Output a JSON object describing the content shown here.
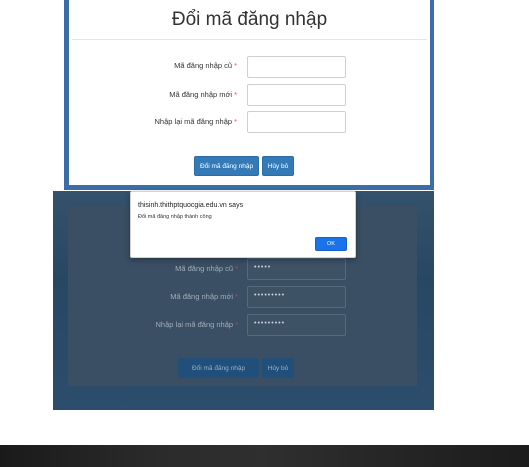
{
  "top_form": {
    "title": "Đổi mã đăng nhập",
    "fields": [
      {
        "label": "Mã đăng nhập cũ",
        "required": "*",
        "value": ""
      },
      {
        "label": "Mã đăng nhập mới",
        "required": "*",
        "value": ""
      },
      {
        "label": "Nhập lại mã đăng nhập",
        "required": "*",
        "value": ""
      }
    ],
    "submit_label": "Đổi mã đăng nhập",
    "cancel_label": "Hủy bỏ"
  },
  "bottom_form": {
    "fields": [
      {
        "label": "Mã đăng nhập cũ",
        "required": "*",
        "value": "•••••"
      },
      {
        "label": "Mã đăng nhập mới",
        "required": "*",
        "value": "•••••••••"
      },
      {
        "label": "Nhập lại mã đăng nhập",
        "required": "*",
        "value": "•••••••••"
      }
    ],
    "submit_label": "Đổi mã đăng nhập",
    "cancel_label": "Hủy bỏ"
  },
  "alert": {
    "title": "thisinh.thithptquocgia.edu.vn says",
    "message": "Đổi mã đăng nhập thành công",
    "ok_label": "OK"
  },
  "colors": {
    "primary": "#337ab7",
    "required": "#d9534f",
    "frame": "#3b6ea8",
    "alert_button": "#1a73e8"
  }
}
